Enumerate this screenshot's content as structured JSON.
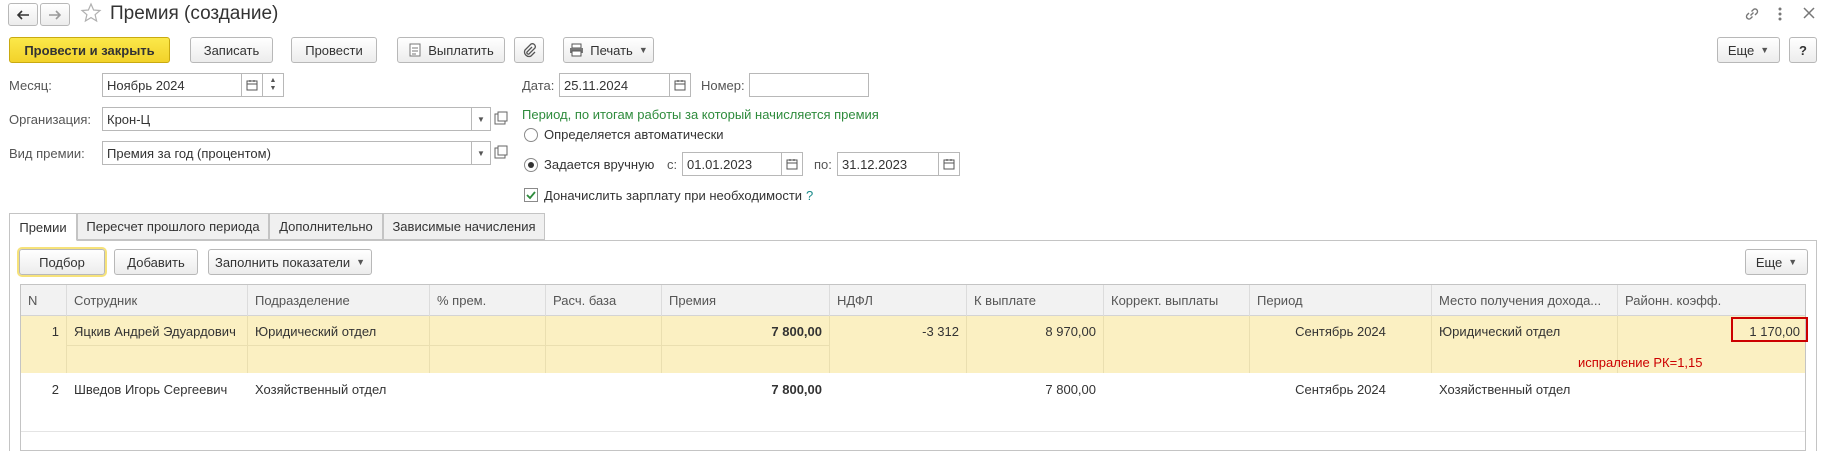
{
  "window": {
    "title": "Премия (создание)",
    "nav_back_icon": "arrow-left-icon",
    "nav_forward_icon": "arrow-right-icon",
    "favorite_icon": "star-icon"
  },
  "toolbar": {
    "post_close": "Провести и закрыть",
    "save": "Записать",
    "post": "Провести",
    "pay": "Выплатить",
    "print": "Печать",
    "more": "Еще",
    "help": "?"
  },
  "form": {
    "month_label": "Месяц:",
    "month_value": "Ноябрь 2024",
    "org_label": "Организация:",
    "org_value": "Крон-Ц",
    "bonus_type_label": "Вид премии:",
    "bonus_type_value": "Премия за год (процентом)",
    "date_label": "Дата:",
    "date_value": "25.11.2024",
    "number_label": "Номер:",
    "number_value": "",
    "period_caption": "Период, по итогам работы за который начисляется премия",
    "auto_option": "Определяется автоматически",
    "manual_option": "Задается вручную",
    "from_label": "с:",
    "from_value": "01.01.2023",
    "to_label": "по:",
    "to_value": "31.12.2023",
    "extra_salary_label": "Доначислить зарплату при необходимости",
    "extra_salary_help": "?"
  },
  "tabs": [
    {
      "label": "Премии"
    },
    {
      "label": "Пересчет прошлого периода"
    },
    {
      "label": "Дополнительно"
    },
    {
      "label": "Зависимые начисления"
    }
  ],
  "table_toolbar": {
    "pick": "Подбор",
    "add": "Добавить",
    "fill": "Заполнить показатели",
    "more": "Еще"
  },
  "table": {
    "columns": [
      "N",
      "Сотрудник",
      "Подразделение",
      "% прем.",
      "Расч. база",
      "Премия",
      "НДФЛ",
      "К выплате",
      "Коррект. выплаты",
      "Период",
      "Место получения дохода...",
      "Районн. коэфф."
    ],
    "rows": [
      {
        "n": "1",
        "employee": "Яцкив Андрей Эдуардович",
        "dept": "Юридический отдел",
        "pct": "",
        "base": "",
        "bonus": "7 800,00",
        "ndfl": "-3 312",
        "payout": "8 970,00",
        "correction": "",
        "period": "Сентябрь 2024",
        "place": "Юридический отдел",
        "coeff": "1 170,00"
      },
      {
        "n": "2",
        "employee": "Шведов Игорь Сергеевич",
        "dept": "Хозяйственный отдел",
        "pct": "",
        "base": "",
        "bonus": "7 800,00",
        "ndfl": "",
        "payout": "7 800,00",
        "correction": "",
        "period": "Сентябрь 2024",
        "place": "Хозяйственный отдел",
        "coeff": ""
      }
    ]
  },
  "annotation": {
    "text": "испраление РК=1,15",
    "color": "#cc0000"
  },
  "colors": {
    "primary_button": "#f2d22a",
    "selected_row": "#fbf0c2",
    "period_caption": "#2e8b3c",
    "help_mark": "#1a8a8a"
  }
}
